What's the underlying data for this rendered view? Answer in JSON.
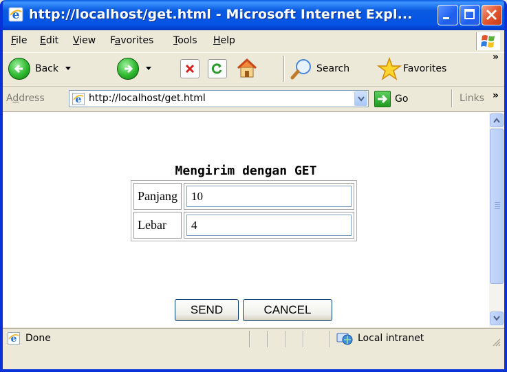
{
  "window": {
    "title": "http://localhost/get.html - Microsoft Internet Expl...",
    "minimize": "minimize",
    "maximize": "maximize",
    "close": "close"
  },
  "menu": {
    "items": [
      {
        "key": "F",
        "rest": "ile"
      },
      {
        "key": "E",
        "rest": "dit"
      },
      {
        "key": "V",
        "rest": "iew"
      },
      {
        "pre": "F",
        "key": "a",
        "rest": "vorites"
      },
      {
        "key": "T",
        "rest": "ools"
      },
      {
        "key": "H",
        "rest": "elp"
      }
    ]
  },
  "toolbar": {
    "back": "Back",
    "search": "Search",
    "favorites": "Favorites",
    "overflow": "»"
  },
  "address": {
    "label_pre": "A",
    "label_key": "d",
    "label_rest": "dress",
    "url": "http://localhost/get.html",
    "go": "Go",
    "links": "Links",
    "overflow": "»"
  },
  "page": {
    "title": "Mengirim dengan GET",
    "rows": [
      {
        "label": "Panjang",
        "value": "10"
      },
      {
        "label": "Lebar",
        "value": "4"
      }
    ],
    "send_label": "SEND",
    "cancel_label": "CANCEL"
  },
  "status": {
    "text": "Done",
    "zone": "Local intranet"
  },
  "colors": {
    "titlebar": "#0a5ae0",
    "chrome": "#ece9d8",
    "border": "#0831d9"
  }
}
